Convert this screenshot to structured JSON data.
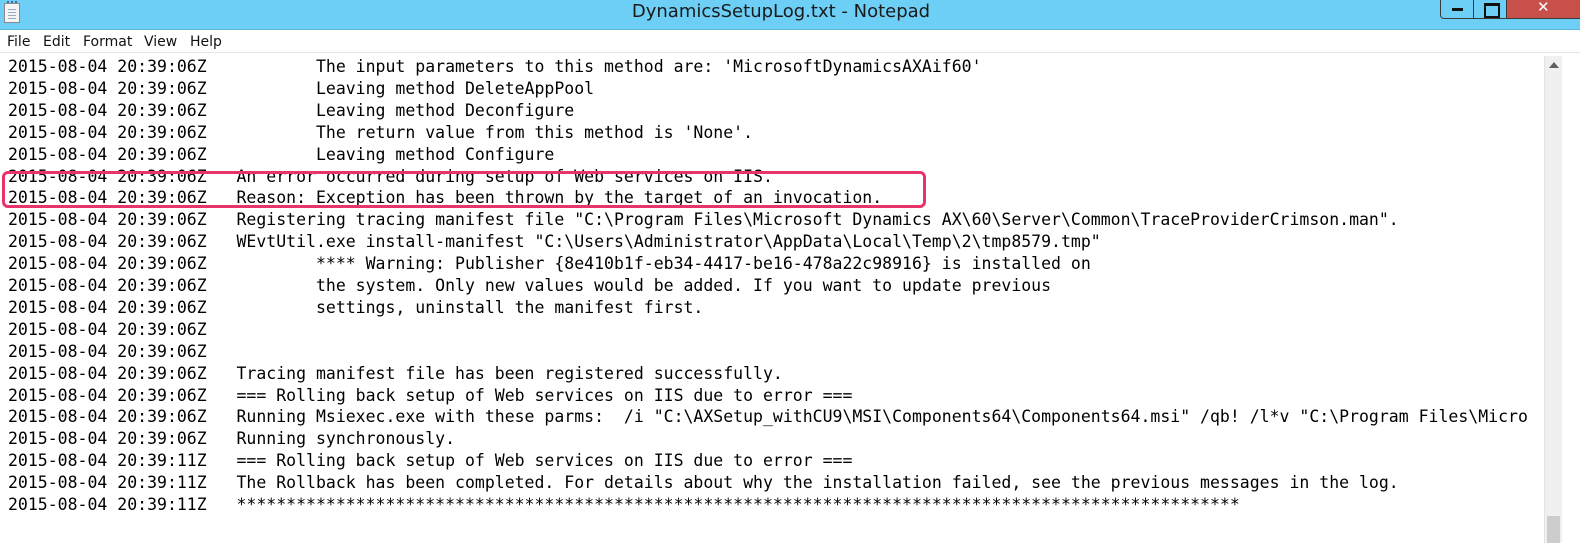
{
  "window": {
    "title": "DynamicsSetupLog.txt - Notepad",
    "icon": "notepad-icon"
  },
  "menu": {
    "file": "File",
    "edit": "Edit",
    "format": "Format",
    "view": "View",
    "help": "Help"
  },
  "log_lines": [
    "2015-08-04 20:39:06Z           The input parameters to this method are: 'MicrosoftDynamicsAXAif60'",
    "2015-08-04 20:39:06Z           Leaving method DeleteAppPool",
    "2015-08-04 20:39:06Z           Leaving method Deconfigure",
    "2015-08-04 20:39:06Z           The return value from this method is 'None'.",
    "2015-08-04 20:39:06Z           Leaving method Configure",
    "2015-08-04 20:39:06Z   An error occurred during setup of Web services on IIS.",
    "2015-08-04 20:39:06Z   Reason: Exception has been thrown by the target of an invocation.",
    "2015-08-04 20:39:06Z   Registering tracing manifest file \"C:\\Program Files\\Microsoft Dynamics AX\\60\\Server\\Common\\TraceProviderCrimson.man\".",
    "2015-08-04 20:39:06Z   WEvtUtil.exe install-manifest \"C:\\Users\\Administrator\\AppData\\Local\\Temp\\2\\tmp8579.tmp\"",
    "2015-08-04 20:39:06Z           **** Warning: Publisher {8e410b1f-eb34-4417-be16-478a22c98916} is installed on",
    "2015-08-04 20:39:06Z           the system. Only new values would be added. If you want to update previous",
    "2015-08-04 20:39:06Z           settings, uninstall the manifest first.",
    "2015-08-04 20:39:06Z",
    "2015-08-04 20:39:06Z",
    "2015-08-04 20:39:06Z   Tracing manifest file has been registered successfully.",
    "2015-08-04 20:39:06Z   === Rolling back setup of Web services on IIS due to error ===",
    "2015-08-04 20:39:06Z   Running Msiexec.exe with these parms:  /i \"C:\\AXSetup_withCU9\\MSI\\Components64\\Components64.msi\" /qb! /l*v \"C:\\Program Files\\Micro",
    "2015-08-04 20:39:06Z   Running synchronously.",
    "2015-08-04 20:39:11Z   === Rolling back setup of Web services on IIS due to error ===",
    "2015-08-04 20:39:11Z   The Rollback has been completed. For details about why the installation failed, see the previous messages in the log.",
    "2015-08-04 20:39:11Z   *****************************************************************************************************"
  ],
  "highlight": {
    "color": "#e8336b"
  },
  "colors": {
    "titlebar": "#6dcff6",
    "close_button": "#c7504b"
  }
}
